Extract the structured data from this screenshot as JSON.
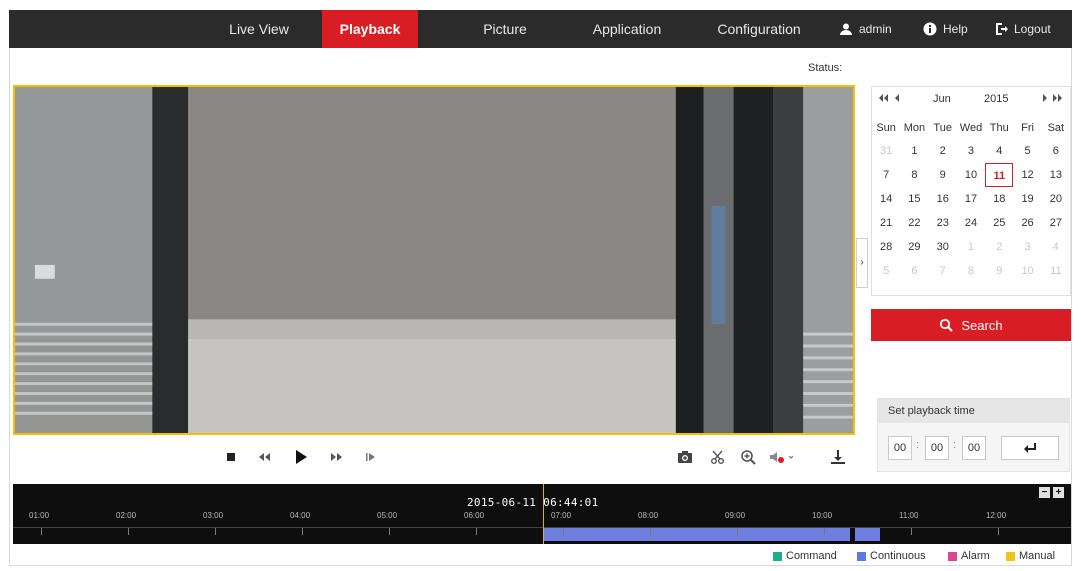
{
  "nav": {
    "items": [
      {
        "label": "Live View"
      },
      {
        "label": "Playback"
      },
      {
        "label": "Picture"
      },
      {
        "label": "Application"
      },
      {
        "label": "Configuration"
      }
    ],
    "user": "admin",
    "help": "Help",
    "logout": "Logout"
  },
  "status_label": "Status:",
  "calendar": {
    "month": "Jun",
    "year": "2015",
    "weekdays": [
      "Sun",
      "Mon",
      "Tue",
      "Wed",
      "Thu",
      "Fri",
      "Sat"
    ],
    "days": [
      "31",
      "1",
      "2",
      "3",
      "4",
      "5",
      "6",
      "7",
      "8",
      "9",
      "10",
      "11",
      "12",
      "13",
      "14",
      "15",
      "16",
      "17",
      "18",
      "19",
      "20",
      "21",
      "22",
      "23",
      "24",
      "25",
      "26",
      "27",
      "28",
      "29",
      "30",
      "1",
      "2",
      "3",
      "4",
      "5",
      "6",
      "7",
      "8",
      "9",
      "10",
      "11"
    ],
    "selected": "11"
  },
  "search_label": "Search",
  "playback_time": {
    "title": "Set playback time",
    "hh": "00",
    "mm": "00",
    "ss": "00"
  },
  "timeline": {
    "datetime": "2015-06-11 06:44:01",
    "hours": [
      "01:00",
      "02:00",
      "03:00",
      "04:00",
      "05:00",
      "06:00",
      "07:00",
      "08:00",
      "09:00",
      "10:00",
      "11:00",
      "12:00"
    ]
  },
  "legend": [
    {
      "label": "Command",
      "color": "#1fae8b"
    },
    {
      "label": "Continuous",
      "color": "#5b78e3"
    },
    {
      "label": "Alarm",
      "color": "#e2458f"
    },
    {
      "label": "Manual",
      "color": "#f0c419"
    }
  ],
  "colors": {
    "accent": "#d81e24",
    "record": "#6e7fe0"
  }
}
